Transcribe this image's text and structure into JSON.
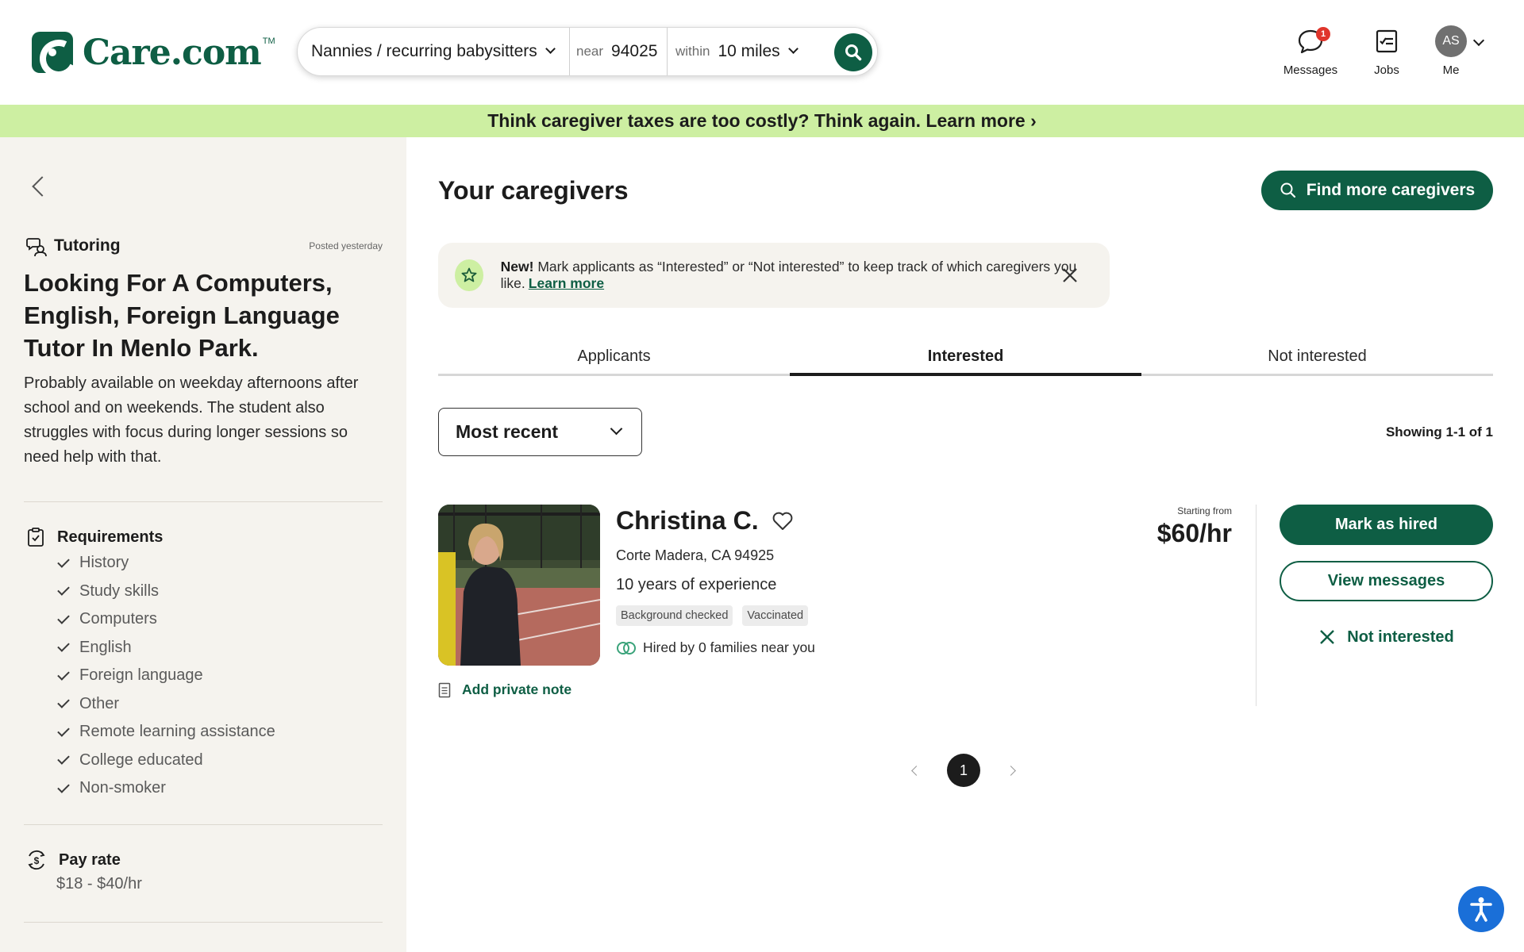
{
  "header": {
    "logo_text": "Care.com",
    "logo_tm": "TM",
    "search": {
      "service": "Nannies / recurring babysitters",
      "near_label": "near",
      "zip": "94025",
      "within_label": "within",
      "distance": "10 miles"
    },
    "nav": {
      "messages_label": "Messages",
      "messages_badge": "1",
      "jobs_label": "Jobs",
      "me_label": "Me",
      "avatar_initials": "AS"
    }
  },
  "promo_banner": "Think caregiver taxes are too costly? Think again. Learn more ›",
  "sidebar": {
    "job_type": "Tutoring",
    "posted": "Posted yesterday",
    "title": "Looking For A Computers, English, Foreign Language Tutor In Menlo Park.",
    "description": "Probably available on weekday afternoons after school and on weekends. The student also struggles with focus during longer sessions so need help with that.",
    "requirements_heading": "Requirements",
    "requirements": [
      "History",
      "Study skills",
      "Computers",
      "English",
      "Foreign language",
      "Other",
      "Remote learning assistance",
      "College educated",
      "Non-smoker"
    ],
    "pay_heading": "Pay rate",
    "pay_value": "$18 - $40/hr"
  },
  "main": {
    "title": "Your caregivers",
    "find_more_button": "Find more caregivers",
    "notice": {
      "new_label": "New!",
      "text": " Mark applicants as “Interested” or “Not interested” to keep track of which caregivers you like.",
      "link": "Learn more"
    },
    "tabs": [
      "Applicants",
      "Interested",
      "Not interested"
    ],
    "active_tab": "Interested",
    "sort_value": "Most recent",
    "showing": "Showing 1-1 of 1",
    "caregiver": {
      "name": "Christina C.",
      "location": "Corte Madera, CA 94925",
      "experience": "10 years of experience",
      "badges": [
        "Background checked",
        "Vaccinated"
      ],
      "hired_text": "Hired by 0 families near you",
      "rate_label": "Starting from",
      "rate": "$60/hr",
      "add_note": "Add private note",
      "hire_button": "Mark as hired",
      "messages_button": "View messages",
      "not_interested_button": "Not interested"
    },
    "pagination": {
      "current_page": "1"
    }
  },
  "colors": {
    "brand_green": "#0e5e44",
    "promo_green": "#cdefa2",
    "sidebar_bg": "#f5f3ee",
    "badge_red": "#e0352b",
    "accessibility_blue": "#1a6fd8"
  }
}
